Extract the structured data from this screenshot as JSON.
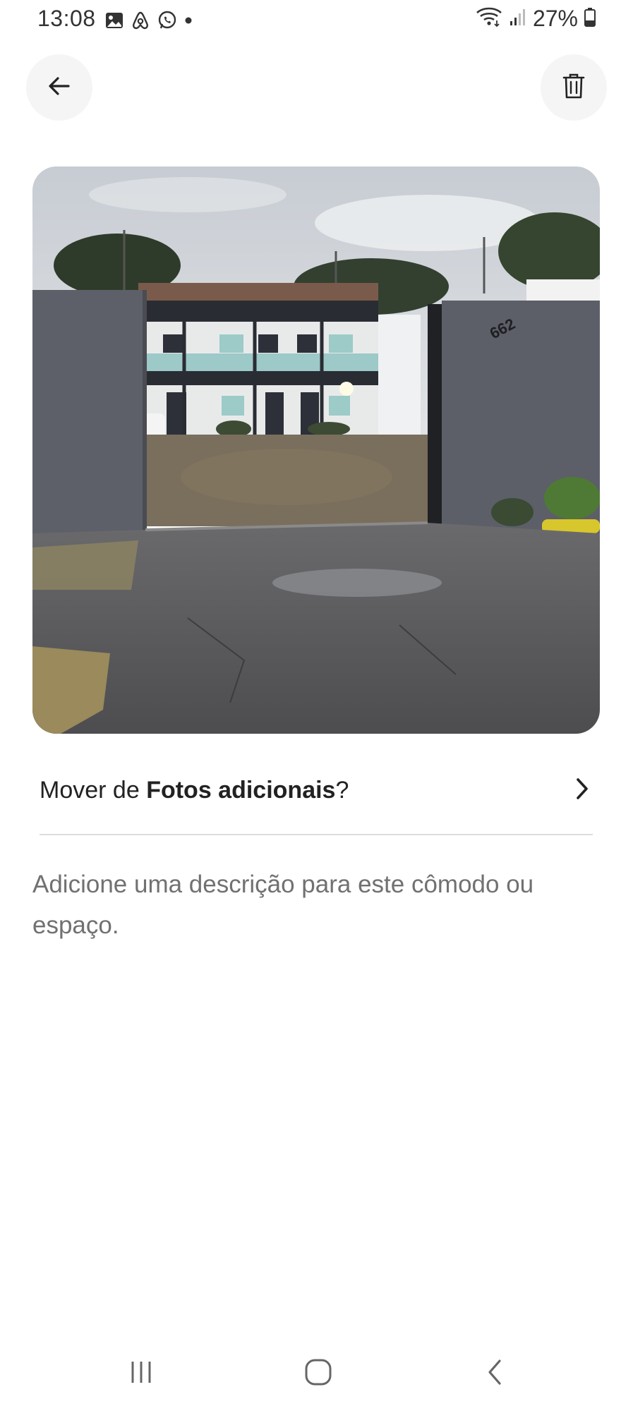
{
  "status_bar": {
    "time": "13:08",
    "left_icons": [
      "gallery-icon",
      "airbnb-icon",
      "whatsapp-icon",
      "notification-dot-icon"
    ],
    "right_icons": [
      "wifi-icon",
      "signal-icon",
      "battery-icon"
    ],
    "battery": "27%"
  },
  "header": {
    "back_icon": "arrow-left-icon",
    "delete_icon": "trash-icon"
  },
  "photo": {
    "address_number": "662"
  },
  "move_row": {
    "prefix": "Mover de ",
    "album": "Fotos adicionais",
    "suffix": "?",
    "icon": "chevron-right-icon"
  },
  "description": {
    "placeholder": "Adicione uma descrição para este cômodo ou espaço."
  },
  "nav_bar": {
    "icons": [
      "recent-apps-icon",
      "home-icon",
      "back-icon"
    ]
  },
  "colors": {
    "text_primary": "#222222",
    "text_secondary": "#717171",
    "button_bg": "#f5f5f5",
    "divider": "#dddddd"
  }
}
